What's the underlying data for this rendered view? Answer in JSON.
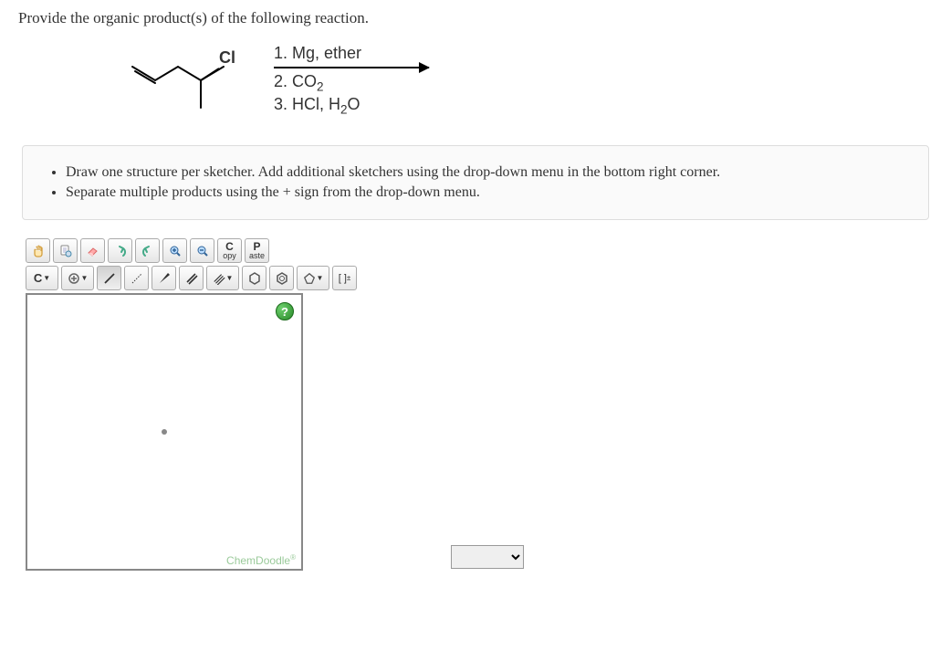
{
  "question": "Provide the organic product(s) of the following reaction.",
  "reaction": {
    "reactant_label": "Cl",
    "step1": "1. Mg, ether",
    "step2": "2. CO",
    "step2_sub": "2",
    "step3": "3. HCl, H",
    "step3_sub": "2",
    "step3_tail": "O"
  },
  "instructions": {
    "item1": "Draw one structure per sketcher. Add additional sketchers using the drop-down menu in the bottom right corner.",
    "item2": "Separate multiple products using the + sign from the drop-down menu."
  },
  "toolbar1": {
    "copy_top": "C",
    "copy_bot": "opy",
    "paste_top": "P",
    "paste_bot": "aste"
  },
  "toolbar2": {
    "element": "C",
    "charge": "[ ]",
    "charge_sup": "±"
  },
  "canvas": {
    "help": "?",
    "brand": "ChemDoodle",
    "brand_sup": "®"
  }
}
